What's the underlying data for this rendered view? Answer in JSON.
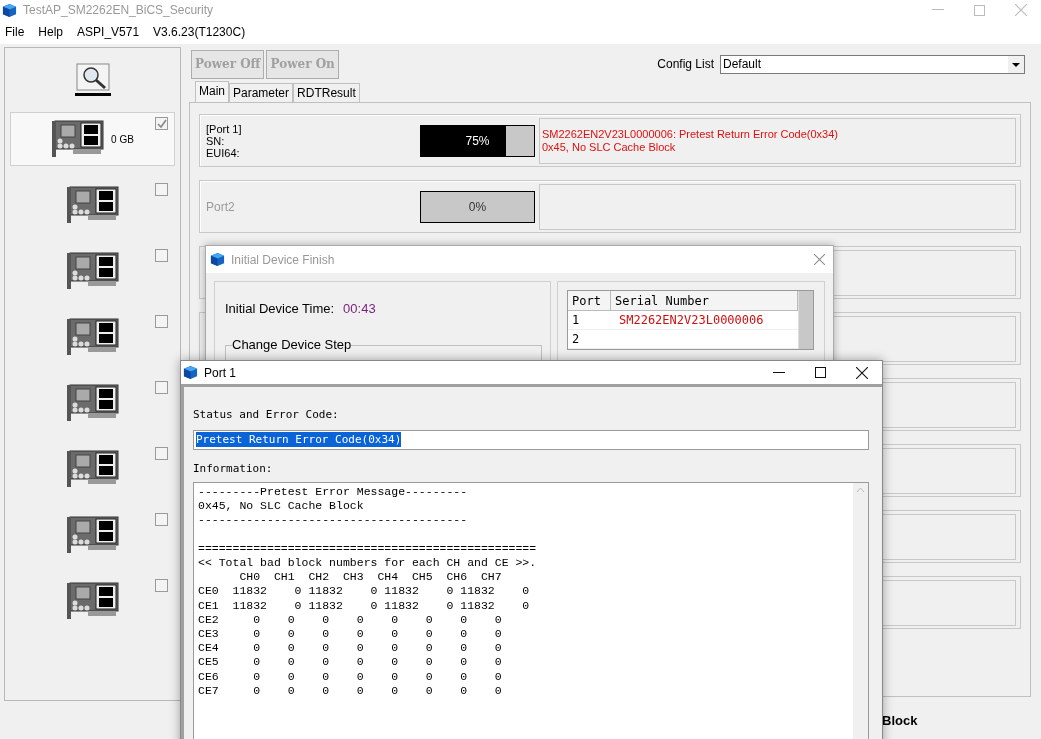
{
  "window": {
    "title": "TestAP_SM2262EN_BiCS_Security"
  },
  "menu": [
    "File",
    "Help",
    "ASPI_V571",
    "V3.6.23(T1230C)"
  ],
  "devices": [
    {
      "capacity": "0 GB",
      "checked": true,
      "selected": true
    },
    {
      "checked": false,
      "selected": false
    },
    {
      "checked": false,
      "selected": false
    },
    {
      "checked": false,
      "selected": false
    },
    {
      "checked": false,
      "selected": false
    },
    {
      "checked": false,
      "selected": false
    },
    {
      "checked": false,
      "selected": false
    },
    {
      "checked": false,
      "selected": false
    }
  ],
  "toolbar": {
    "buttons": [
      {
        "label": "Power Off",
        "disabled": true
      },
      {
        "label": "Power On",
        "disabled": true
      }
    ],
    "config_label": "Config List",
    "config_value": "Default"
  },
  "tabs": [
    {
      "label": "Main",
      "selected": true
    },
    {
      "label": "Parameter",
      "selected": false
    },
    {
      "label": "RDTResult",
      "selected": false
    }
  ],
  "ports": [
    {
      "lines": [
        "[Port 1]",
        "SN:",
        "EUI64:"
      ],
      "active": true,
      "level": 0.75,
      "reading": "75%",
      "messages": [
        "SM2262EN2V23L0000006: Pretest Return Error Code(0x34)",
        "0x45, No SLC Cache Block"
      ]
    },
    {
      "lines": [
        "Port2"
      ],
      "active": false,
      "level": 0,
      "reading": "0%"
    }
  ],
  "status_text": "Block",
  "init_dialog": {
    "title": "Initial Device Finish",
    "time_label": "Initial Device Time:",
    "time_value": "00:43",
    "group_label": "Change Device Step",
    "columns": [
      "Port",
      "Serial Number"
    ],
    "rows": [
      {
        "port": "1",
        "serial": "SM2262EN2V23L0000006"
      },
      {
        "port": "2"
      }
    ]
  },
  "port_dialog": {
    "title": "Port 1",
    "status_label": "Status and Error Code:",
    "status_value": "Pretest Return Error Code(0x34)",
    "info_label": "Information:",
    "info_blocks": [
      [
        "---------Pretest Error Message---------",
        "0x45, No SLC Cache Block",
        "---------------------------------------"
      ],
      [
        "=================================================",
        "<< Total bad block numbers for each CH and CE >>.",
        "      CH0  CH1  CH2  CH3  CH4  CH5  CH6  CH7",
        "CE0  11832    0 11832    0 11832    0 11832    0",
        "CE1  11832    0 11832    0 11832    0 11832    0",
        "CE2     0    0    0    0    0    0    0    0",
        "CE3     0    0    0    0    0    0    0    0",
        "CE4     0    0    0    0    0    0    0    0",
        "CE5     0    0    0    0    0    0    0    0",
        "CE6     0    0    0    0    0    0    0    0",
        "CE7     0    0    0    0    0    0    0    0"
      ]
    ]
  }
}
